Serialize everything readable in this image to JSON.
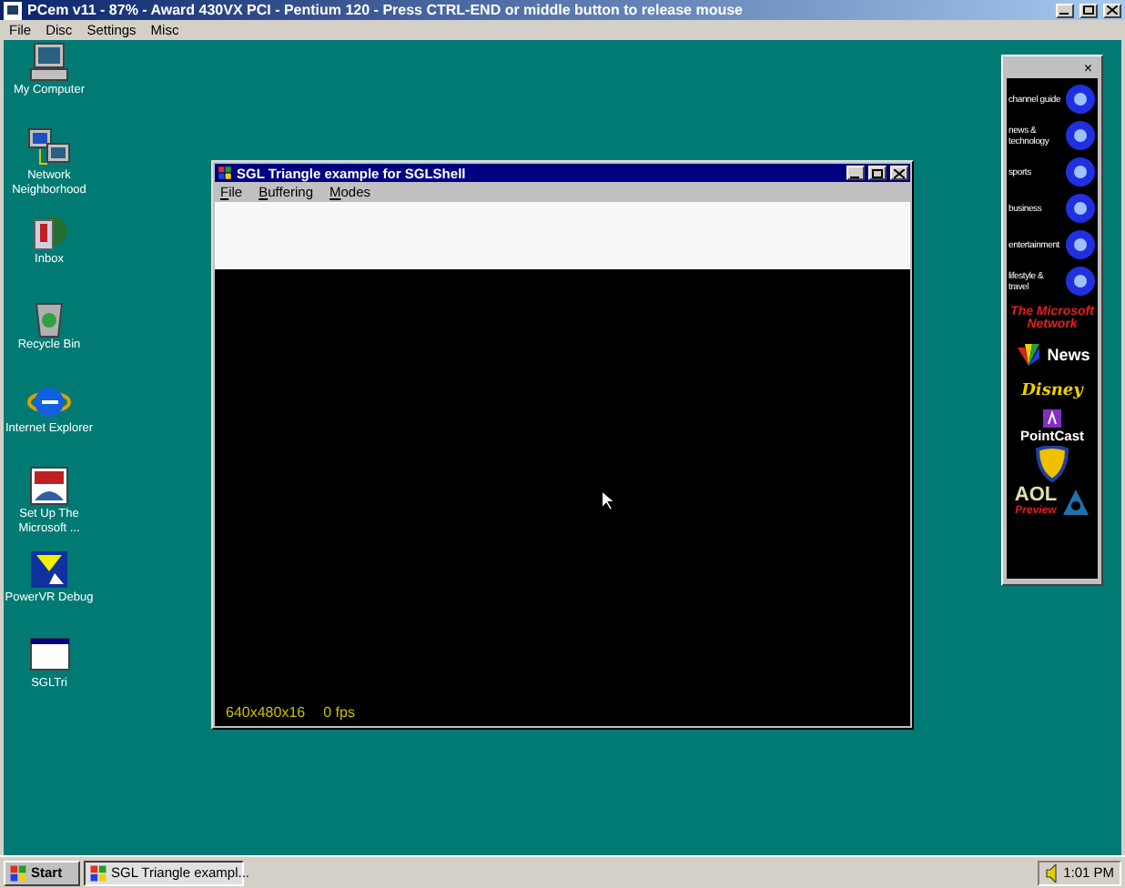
{
  "host_window": {
    "title": "PCem v11 - 87% - Award 430VX PCI - Pentium 120 - Press CTRL-END or middle button to release mouse",
    "menu": [
      "File",
      "Disc",
      "Settings",
      "Misc"
    ]
  },
  "desktop_icons": [
    {
      "label": "My Computer",
      "kind": "computer"
    },
    {
      "label": "Network Neighborhood",
      "kind": "network"
    },
    {
      "label": "Inbox",
      "kind": "inbox"
    },
    {
      "label": "Recycle Bin",
      "kind": "recycle"
    },
    {
      "label": "Internet Explorer",
      "kind": "browser"
    },
    {
      "label": "Set Up The Microsoft ...",
      "kind": "msn"
    },
    {
      "label": "PowerVR Debug",
      "kind": "powervr"
    },
    {
      "label": "SGLTri",
      "kind": "app"
    }
  ],
  "app_window": {
    "title": "SGL Triangle example for SGLShell",
    "menu": [
      "File",
      "Buffering",
      "Modes"
    ],
    "mode": "640x480x16",
    "fps": "0 fps"
  },
  "channel_bar_close": "×",
  "channel_bar": [
    {
      "kind": "channel",
      "label": "channel guide"
    },
    {
      "kind": "channel",
      "label": "news & technology"
    },
    {
      "kind": "channel",
      "label": "sports"
    },
    {
      "kind": "channel",
      "label": "business"
    },
    {
      "kind": "channel",
      "label": "entertainment"
    },
    {
      "kind": "channel",
      "label": "lifestyle & travel"
    },
    {
      "kind": "msn",
      "label": "The Microsoft Network"
    },
    {
      "kind": "news",
      "label": "News"
    },
    {
      "kind": "disney",
      "label": "Disney"
    },
    {
      "kind": "pointcast",
      "label": "PointCast"
    },
    {
      "kind": "wb"
    },
    {
      "kind": "aol",
      "label": "AOL",
      "sublabel": "Preview"
    }
  ],
  "taskbar": {
    "start": "Start",
    "tasks": [
      {
        "label": "SGL Triangle exampl...",
        "selected": true
      }
    ],
    "clock": "1:01 PM"
  }
}
